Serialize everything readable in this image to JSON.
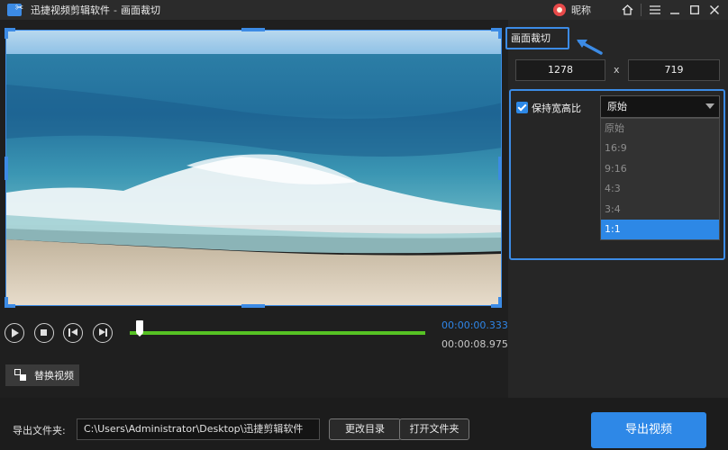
{
  "titlebar": {
    "app_name": "迅捷视频剪辑软件",
    "separator": "-",
    "page_name": "画面裁切",
    "user_name": "昵称",
    "icons": [
      "home-icon",
      "menu-icon",
      "minimize-icon",
      "maximize-icon",
      "close-icon"
    ]
  },
  "player": {
    "current_time": "00:00:00.333",
    "total_time": "00:00:08.975",
    "controls": [
      "play-icon",
      "stop-icon",
      "prev-frame-icon",
      "next-frame-icon"
    ],
    "progress_fraction": 0.037,
    "replace_label": "替换视频"
  },
  "crop": {
    "header": "画面裁切",
    "width": "1278",
    "x_sep": "x",
    "height": "719",
    "keep_ratio_label": "保持宽高比",
    "keep_ratio_checked": true,
    "ratio_selected": "原始",
    "ratio_options": [
      "原始",
      "16:9",
      "9:16",
      "4:3",
      "3:4",
      "1:1"
    ],
    "ratio_highlighted": "1:1"
  },
  "footer": {
    "export_label": "导出文件夹:",
    "export_path": "C:\\Users\\Administrator\\Desktop\\迅捷剪辑软件",
    "change_dir_label": "更改目录",
    "open_folder_label": "打开文件夹",
    "export_button_label": "导出视频"
  },
  "colors": {
    "accent": "#3c8be5",
    "progress": "#56c224",
    "background": "#1f1f1f"
  }
}
